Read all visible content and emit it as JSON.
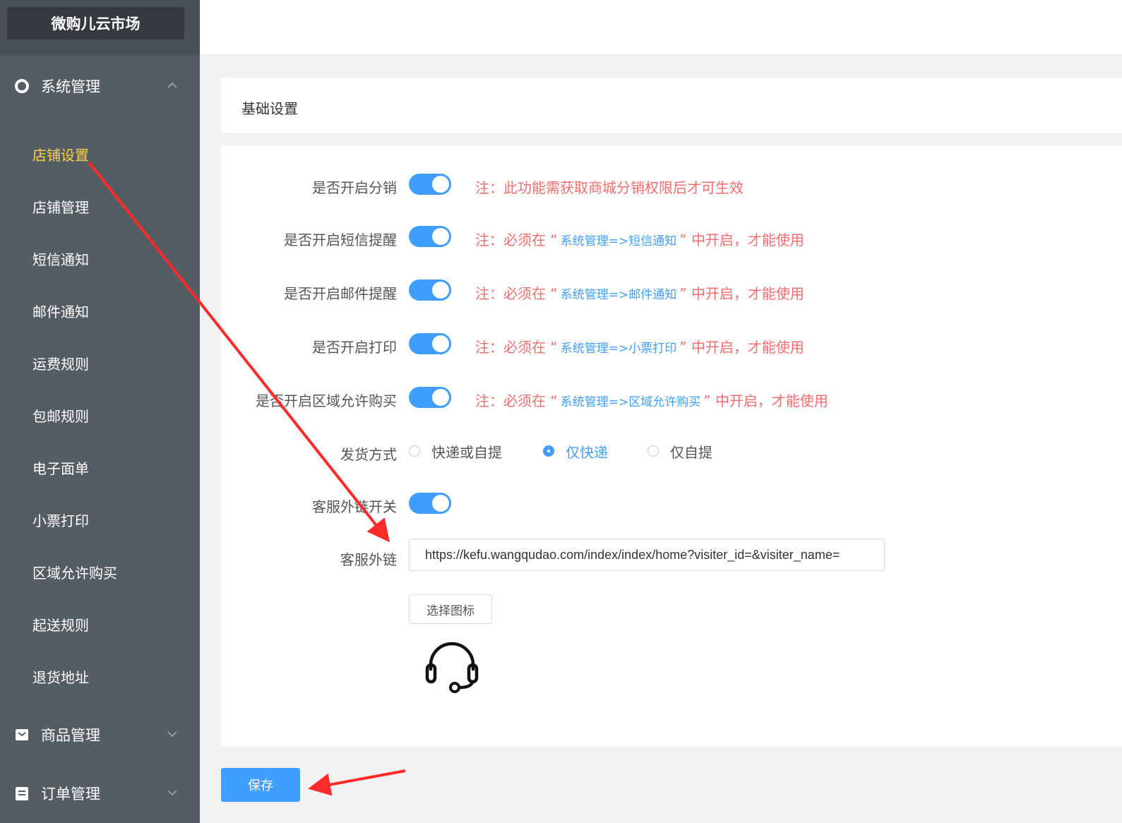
{
  "brand": "微购儿云市场",
  "sidebar": {
    "groups": [
      {
        "label": "系统管理",
        "icon": "gear-icon",
        "chevron": "^"
      },
      {
        "label": "商品管理",
        "icon": "goods-icon",
        "chevron": "v"
      },
      {
        "label": "订单管理",
        "icon": "order-icon",
        "chevron": "v"
      }
    ],
    "items": [
      "店铺设置",
      "店铺管理",
      "短信通知",
      "邮件通知",
      "运费规则",
      "包邮规则",
      "电子面单",
      "小票打印",
      "区域允许购买",
      "起送规则",
      "退货地址"
    ],
    "active_index": 0
  },
  "panel": {
    "title": "基础设置"
  },
  "settings": [
    {
      "label": "是否开启分销",
      "on": true,
      "note": "注：此功能需获取商城分销权限后才可生效"
    },
    {
      "label": "是否开启短信提醒",
      "on": true,
      "note_pre": "注：必须在 “",
      "note_link": "系统管理=>短信通知",
      "note_post": "” 中开启，才能使用"
    },
    {
      "label": "是否开启邮件提醒",
      "on": true,
      "note_pre": "注：必须在 “",
      "note_link": "系统管理=>邮件通知",
      "note_post": "” 中开启，才能使用"
    },
    {
      "label": "是否开启打印",
      "on": true,
      "note_pre": "注：必须在 “",
      "note_link": "系统管理=>小票打印",
      "note_post": "” 中开启，才能使用"
    },
    {
      "label": "是否开启区域允许购买",
      "on": true,
      "note_pre": "注：必须在 “",
      "note_link": "系统管理=>区域允许购买",
      "note_post": "” 中开启，才能使用"
    }
  ],
  "delivery": {
    "label": "发货方式",
    "options": [
      "快递或自提",
      "仅快递",
      "仅自提"
    ],
    "selected": "仅快递"
  },
  "service_switch": {
    "label": "客服外链开关",
    "on": true
  },
  "service_link": {
    "label": "客服外链",
    "value": "https://kefu.wangqudao.com/index/index/home?visiter_id=&visiter_name="
  },
  "choose_icon_label": "选择图标",
  "service_icon": "headset-icon",
  "save_label": "保存",
  "colors": {
    "primary": "#409eff",
    "warning": "#f56c6c",
    "sidebar": "#545c64",
    "active_menu": "#ffd04b",
    "annotation_arrow": "#ff2a2a"
  }
}
